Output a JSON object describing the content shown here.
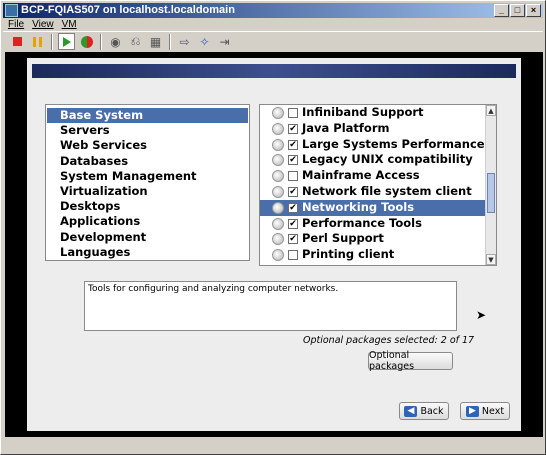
{
  "window": {
    "title": "BCP-FQIAS507 on localhost.localdomain"
  },
  "menu": [
    {
      "label": "File",
      "key": "F"
    },
    {
      "label": "View",
      "key": "V"
    },
    {
      "label": "VM",
      "key": "V"
    }
  ],
  "toolbar": {
    "icons": [
      "stop-icon",
      "pause-icon",
      "play-icon",
      "reset-icon",
      "snapshot-icon",
      "revert-icon",
      "manage-snapshots-icon",
      "send-icon",
      "receive-icon",
      "disconnect-icon"
    ]
  },
  "groups": {
    "items": [
      {
        "label": "Base System",
        "selected": true
      },
      {
        "label": "Servers"
      },
      {
        "label": "Web Services"
      },
      {
        "label": "Databases"
      },
      {
        "label": "System Management"
      },
      {
        "label": "Virtualization"
      },
      {
        "label": "Desktops"
      },
      {
        "label": "Applications"
      },
      {
        "label": "Development"
      },
      {
        "label": "Languages"
      }
    ]
  },
  "packages": {
    "items": [
      {
        "label": "Infiniband Support",
        "checked": false
      },
      {
        "label": "Java Platform",
        "checked": true
      },
      {
        "label": "Large Systems Performance",
        "checked": true
      },
      {
        "label": "Legacy UNIX compatibility",
        "checked": true
      },
      {
        "label": "Mainframe Access",
        "checked": false
      },
      {
        "label": "Network file system client",
        "checked": true
      },
      {
        "label": "Networking Tools",
        "checked": true,
        "selected": true
      },
      {
        "label": "Performance Tools",
        "checked": true
      },
      {
        "label": "Perl Support",
        "checked": true
      },
      {
        "label": "Printing client",
        "checked": false
      }
    ]
  },
  "description": "Tools for configuring and analyzing computer networks.",
  "optional_count": "Optional packages selected: 2 of 17",
  "buttons": {
    "optional": "Optional packages",
    "back": "Back",
    "next": "Next"
  },
  "colors": {
    "selection": "#4a6ea9",
    "titlebar": "#0a246a"
  }
}
